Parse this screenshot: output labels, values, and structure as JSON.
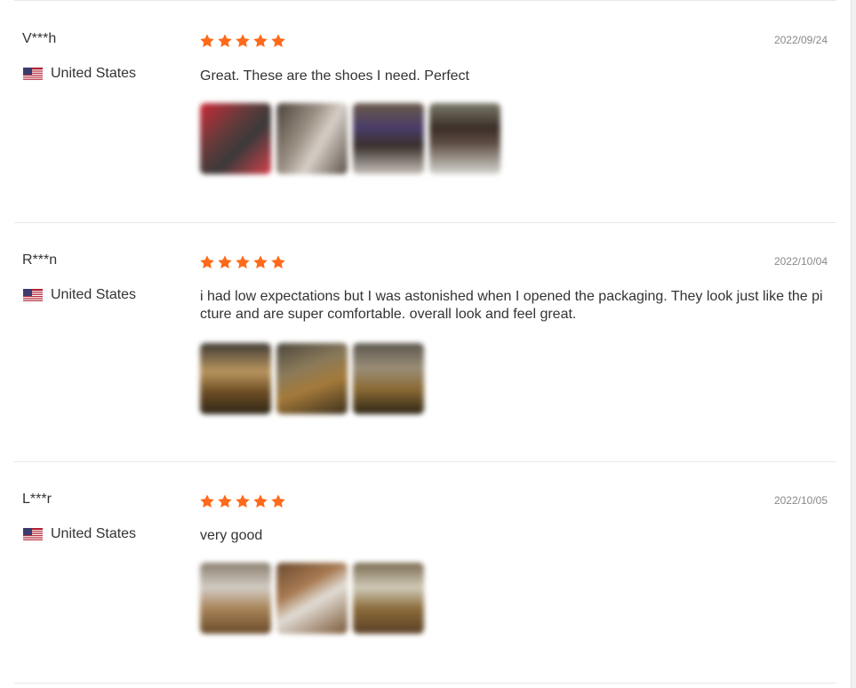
{
  "colors": {
    "star": "#ff6a1a",
    "date": "#888888",
    "text": "#333333",
    "divider": "#e8e8e8"
  },
  "reviews": [
    {
      "user": "V***h",
      "country": "United States",
      "flag_icon": "us-flag-icon",
      "rating": 5,
      "date": "2022/09/24",
      "text": "Great. These are the shoes I need. Perfect",
      "photo_count": 4
    },
    {
      "user": "R***n",
      "country": "United States",
      "flag_icon": "us-flag-icon",
      "rating": 5,
      "date": "2022/10/04",
      "text": "i had low expectations but I was astonished when I opened the packaging. They look just like the picture and are super comfortable. overall look and feel great.",
      "photo_count": 3
    },
    {
      "user": "L***r",
      "country": "United States",
      "flag_icon": "us-flag-icon",
      "rating": 5,
      "date": "2022/10/05",
      "text": "very good",
      "photo_count": 3
    }
  ]
}
